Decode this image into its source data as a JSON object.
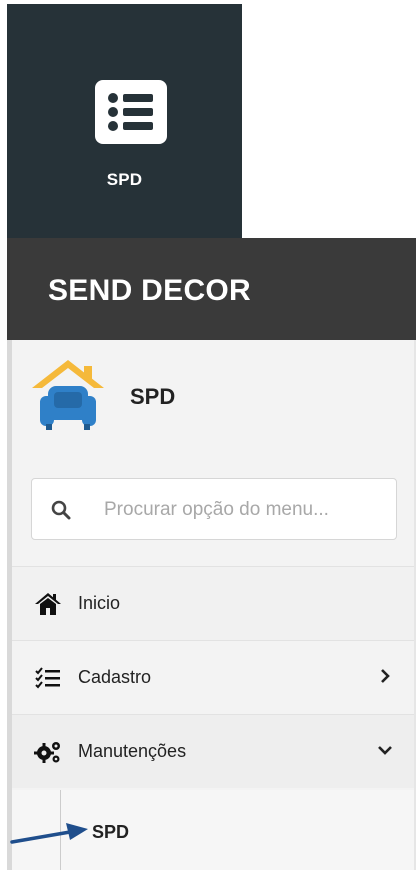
{
  "app_tile": {
    "label": "SPD",
    "icon": "list-icon",
    "background": "#263238"
  },
  "header": {
    "brand": "SEND DECOR",
    "background": "#3a3a3a"
  },
  "sidebar": {
    "profile": {
      "name": "SPD",
      "logo_icon": "armchair-house-logo",
      "logo_colors": {
        "roof": "#f5b93a",
        "chair": "#2f80c8"
      }
    },
    "search": {
      "placeholder": "Procurar opção do menu...",
      "value": "",
      "icon": "search-icon"
    },
    "items": [
      {
        "label": "Inicio",
        "icon": "home-icon",
        "chevron": null
      },
      {
        "label": "Cadastro",
        "icon": "checklist-icon",
        "chevron": "chevron-right-icon"
      },
      {
        "label": "Manutenções",
        "icon": "gears-icon",
        "chevron": "chevron-down-icon"
      }
    ],
    "submenu": [
      {
        "label": "SPD"
      }
    ]
  },
  "annotation": {
    "arrow_icon": "arrow-right-icon",
    "arrow_color": "#1f4e8c"
  }
}
